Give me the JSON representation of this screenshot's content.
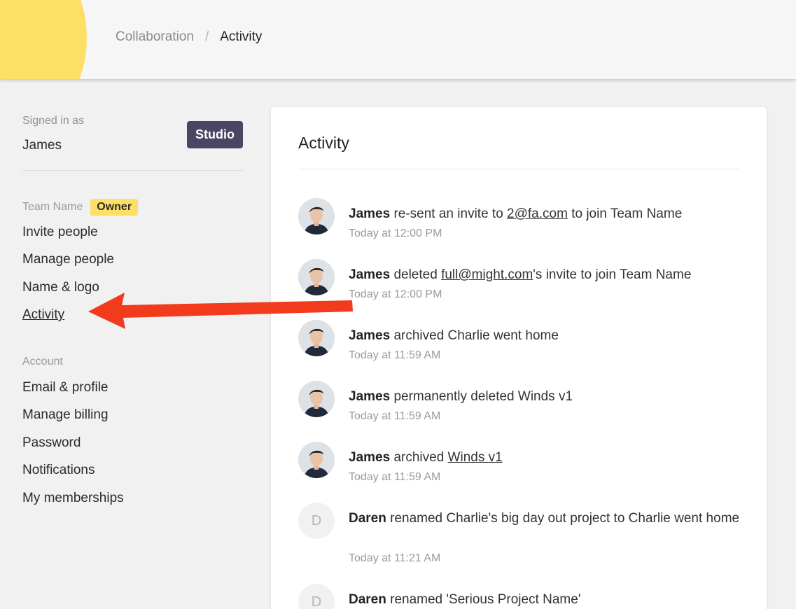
{
  "header": {
    "breadcrumb_parent": "Collaboration",
    "breadcrumb_separator": "/",
    "breadcrumb_current": "Activity",
    "logo_icon": "pencil-icon",
    "accent_color": "#fedf66"
  },
  "sidebar": {
    "signed_in_label": "Signed in as",
    "user_name": "James",
    "plan_badge": "Studio",
    "team_name": "Team Name",
    "role_badge": "Owner",
    "team_items": [
      {
        "label": "Invite people"
      },
      {
        "label": "Manage people"
      },
      {
        "label": "Name & logo"
      },
      {
        "label": "Activity",
        "active": true
      }
    ],
    "account_label": "Account",
    "account_items": [
      {
        "label": "Email & profile"
      },
      {
        "label": "Manage billing"
      },
      {
        "label": "Password"
      },
      {
        "label": "Notifications"
      },
      {
        "label": "My memberships"
      }
    ]
  },
  "main": {
    "title": "Activity",
    "activities": [
      {
        "actor": "James",
        "avatar": "photo",
        "pre": " re-sent an invite to ",
        "link": "2@fa.com",
        "post": " to join Team Name",
        "time": "Today at 12:00 PM"
      },
      {
        "actor": "James",
        "avatar": "photo",
        "pre": " deleted ",
        "link": "full@might.com",
        "post": "'s invite to join Team Name",
        "time": "Today at 12:00 PM"
      },
      {
        "actor": "James",
        "avatar": "photo",
        "pre": " archived Charlie went home",
        "link": "",
        "post": "",
        "time": "Today at 11:59 AM"
      },
      {
        "actor": "James",
        "avatar": "photo",
        "pre": " permanently deleted Winds v1",
        "link": "",
        "post": "",
        "time": "Today at 11:59 AM"
      },
      {
        "actor": "James",
        "avatar": "photo",
        "pre": " archived ",
        "link": "Winds v1",
        "post": "",
        "time": "Today at 11:59 AM"
      },
      {
        "actor": "Daren",
        "avatar": "initial",
        "initial": "D",
        "pre": " renamed Charlie's big day out project to Charlie went home",
        "link": "",
        "post": "",
        "time": "Today at 11:21 AM"
      },
      {
        "actor": "Daren",
        "avatar": "initial",
        "initial": "D",
        "pre": " renamed 'Serious Project Name'",
        "link": "",
        "post": "",
        "time": ""
      }
    ]
  },
  "annotation": {
    "arrow_color": "#f23a1d"
  }
}
